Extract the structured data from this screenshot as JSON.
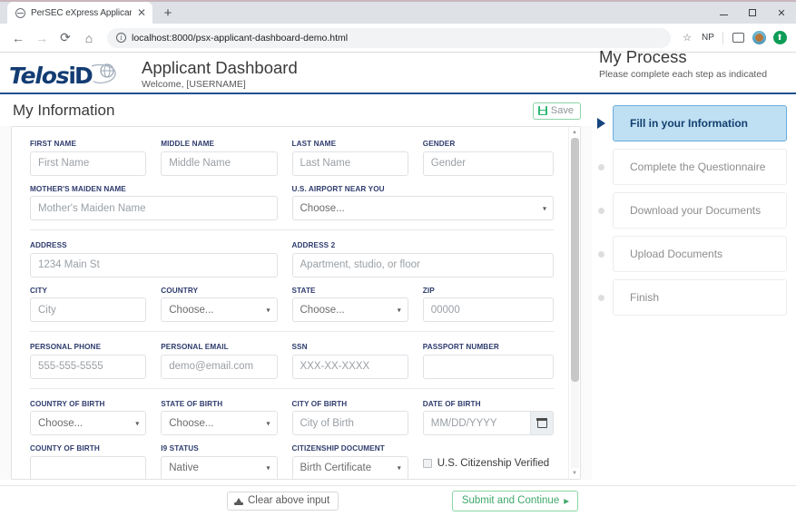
{
  "browser": {
    "tab": {
      "title": "PerSEC eXpress Applicant Dashb",
      "close": "✕",
      "favicon": "globe-icon"
    },
    "newtab_label": "+",
    "window": {
      "minimize": "–",
      "maximize": "□",
      "close": "✕"
    },
    "nav": {
      "back": "←",
      "forward": "→",
      "reload": "⟳",
      "home": "⌂"
    },
    "omnibox": {
      "info": "i",
      "url": "localhost:8000/psx-applicant-dashboard-demo.html"
    },
    "toolbar_right": {
      "bookmark": "☆",
      "profile_initials": "NP",
      "cast": "cast-icon",
      "avatar": "avatar",
      "extension": "⬆"
    }
  },
  "header": {
    "logo_telos": "Telos",
    "logo_id": "iD",
    "title": "Applicant Dashboard",
    "subtitle": "Welcome, [USERNAME]"
  },
  "process": {
    "title": "My Process",
    "subtitle": "Please complete each step as indicated",
    "steps": [
      {
        "label": "Fill in your Information",
        "state": "active"
      },
      {
        "label": "Complete the Questionnaire",
        "state": "idle"
      },
      {
        "label": "Download your Documents",
        "state": "idle"
      },
      {
        "label": "Upload Documents",
        "state": "idle"
      },
      {
        "label": "Finish",
        "state": "idle"
      }
    ]
  },
  "section": {
    "title": "My Information",
    "save_label": "Save"
  },
  "form": {
    "first_name": {
      "label": "First Name",
      "placeholder": "First Name"
    },
    "middle_name": {
      "label": "Middle Name",
      "placeholder": "Middle Name"
    },
    "last_name": {
      "label": "Last Name",
      "placeholder": "Last Name"
    },
    "gender": {
      "label": "Gender",
      "placeholder": "Gender"
    },
    "mothers_maiden": {
      "label": "Mother's Maiden Name",
      "placeholder": "Mother's Maiden Name"
    },
    "airport": {
      "label": "U.S. Airport Near You",
      "value": "Choose..."
    },
    "address": {
      "label": "Address",
      "placeholder": "1234 Main St"
    },
    "address2": {
      "label": "Address 2",
      "placeholder": "Apartment, studio, or floor"
    },
    "city": {
      "label": "City",
      "placeholder": "City"
    },
    "country": {
      "label": "Country",
      "value": "Choose..."
    },
    "state": {
      "label": "State",
      "value": "Choose..."
    },
    "zip": {
      "label": "Zip",
      "placeholder": "00000"
    },
    "personal_phone": {
      "label": "Personal Phone",
      "placeholder": "555-555-5555"
    },
    "personal_email": {
      "label": "Personal Email",
      "placeholder": "demo@email.com"
    },
    "ssn": {
      "label": "SSN",
      "placeholder": "XXX-XX-XXXX"
    },
    "passport_number": {
      "label": "Passport Number",
      "placeholder": ""
    },
    "country_of_birth": {
      "label": "Country of Birth",
      "value": "Choose..."
    },
    "state_of_birth": {
      "label": "State of Birth",
      "value": "Choose..."
    },
    "city_of_birth": {
      "label": "City of Birth",
      "placeholder": "City of Birth"
    },
    "date_of_birth": {
      "label": "Date of Birth",
      "placeholder": "MM/DD/YYYY"
    },
    "county_of_birth": {
      "label": "County of Birth",
      "placeholder": ""
    },
    "i9_status": {
      "label": "I9 Status",
      "value": "Native"
    },
    "citizenship_doc": {
      "label": "Citizenship Document",
      "value": "Birth Certificate"
    },
    "citizenship_verified": {
      "label": "U.S. Citizenship Verified",
      "checked": false
    }
  },
  "footer": {
    "clear_label": "Clear above input",
    "submit_label": "Submit and Continue",
    "submit_arrow": "▸"
  },
  "colors": {
    "navy": "#133c73",
    "rule_blue": "#1f5190",
    "active_step_bg": "#bfdff3",
    "active_step_border": "#6aaedc",
    "green": "#3fa86a",
    "label_navy": "#2f3c6e"
  }
}
